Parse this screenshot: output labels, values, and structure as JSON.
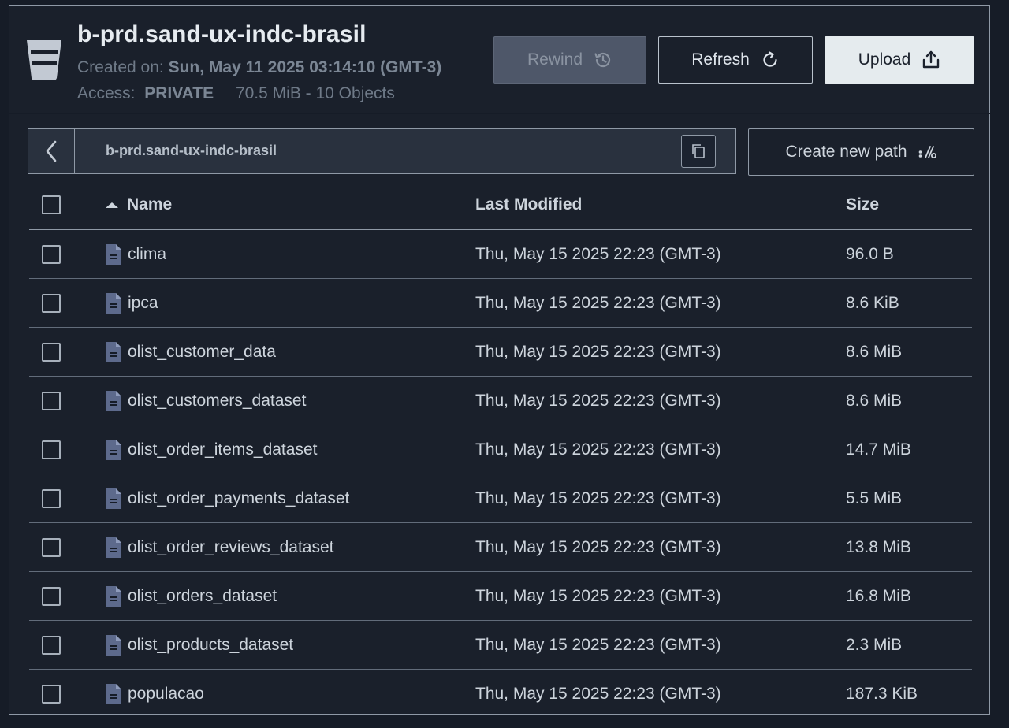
{
  "bucket": {
    "name": "b-prd.sand-ux-indc-brasil",
    "created_label": "Created on:",
    "created_value": "Sun, May 11 2025 03:14:10 (GMT-3)",
    "access_label": "Access:",
    "access_value": "PRIVATE",
    "usage": "70.5 MiB - 10 Objects"
  },
  "toolbar": {
    "rewind_label": "Rewind",
    "refresh_label": "Refresh",
    "upload_label": "Upload"
  },
  "path": {
    "current": "b-prd.sand-ux-indc-brasil",
    "create_new_path_label": "Create new path"
  },
  "table": {
    "headers": {
      "name": "Name",
      "last_modified": "Last Modified",
      "size": "Size"
    },
    "rows": [
      {
        "name": "clima",
        "modified": "Thu, May 15 2025 22:23 (GMT-3)",
        "size": "96.0 B"
      },
      {
        "name": "ipca",
        "modified": "Thu, May 15 2025 22:23 (GMT-3)",
        "size": "8.6 KiB"
      },
      {
        "name": "olist_customer_data",
        "modified": "Thu, May 15 2025 22:23 (GMT-3)",
        "size": "8.6 MiB"
      },
      {
        "name": "olist_customers_dataset",
        "modified": "Thu, May 15 2025 22:23 (GMT-3)",
        "size": "8.6 MiB"
      },
      {
        "name": "olist_order_items_dataset",
        "modified": "Thu, May 15 2025 22:23 (GMT-3)",
        "size": "14.7 MiB"
      },
      {
        "name": "olist_order_payments_dataset",
        "modified": "Thu, May 15 2025 22:23 (GMT-3)",
        "size": "5.5 MiB"
      },
      {
        "name": "olist_order_reviews_dataset",
        "modified": "Thu, May 15 2025 22:23 (GMT-3)",
        "size": "13.8 MiB"
      },
      {
        "name": "olist_orders_dataset",
        "modified": "Thu, May 15 2025 22:23 (GMT-3)",
        "size": "16.8 MiB"
      },
      {
        "name": "olist_products_dataset",
        "modified": "Thu, May 15 2025 22:23 (GMT-3)",
        "size": "2.3 MiB"
      },
      {
        "name": "populacao",
        "modified": "Thu, May 15 2025 22:23 (GMT-3)",
        "size": "187.3 KiB"
      }
    ]
  },
  "colors": {
    "background": "#161c27",
    "panel": "#1a202b",
    "border": "#8f99a6",
    "file_icon": "#5d6a8c",
    "upload_button": "#e5ebee"
  },
  "icons": {
    "bucket": "bucket-icon",
    "rewind": "history-icon",
    "refresh": "refresh-icon",
    "upload": "upload-icon",
    "back": "chevron-left-icon",
    "copy": "copy-icon",
    "new_path": "new-path-icon",
    "file": "file-icon",
    "sort": "sort-ascending-icon"
  }
}
